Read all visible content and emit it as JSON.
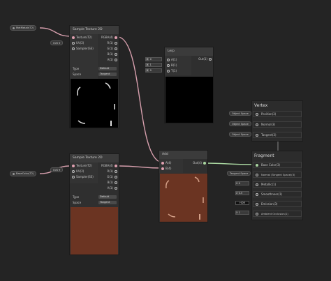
{
  "property_nodes": {
    "mettle": {
      "label": "MetMetalr(T2)"
    },
    "base": {
      "label": "BaseColor(T2)"
    }
  },
  "sample_top": {
    "title": "Sample Texture 2D",
    "inputs": [
      "Texture(T2)",
      "UV(2)",
      "Sampler(SS)"
    ],
    "outputs": [
      "RGBA(4)",
      "R(1)",
      "G(1)",
      "B(1)",
      "A(1)"
    ],
    "uv_chip": "UV0",
    "type_label": "Type",
    "type_value": "Default",
    "space_label": "Space",
    "space_value": "Tangent"
  },
  "sample_bottom": {
    "title": "Sample Texture 2D",
    "inputs": [
      "Texture(T2)",
      "UV(2)",
      "Sampler(SS)"
    ],
    "outputs": [
      "RGBA(4)",
      "R(1)",
      "G(1)",
      "B(1)",
      "A(1)"
    ],
    "uv_chip": "UV0",
    "type_label": "Type",
    "type_value": "Default",
    "space_label": "Space",
    "space_value": "Tangent"
  },
  "lerp": {
    "title": "Lerp",
    "inputs": [
      "A(1)",
      "B(1)",
      "T(1)"
    ],
    "output": "Out(1)",
    "fields": [
      {
        "axis": "X",
        "value": "0"
      },
      {
        "axis": "X",
        "value": "1"
      },
      {
        "axis": "X",
        "value": "0"
      }
    ]
  },
  "add": {
    "title": "Add",
    "inputs": [
      "A(4)",
      "B(4)"
    ],
    "output": "Out(4)"
  },
  "vertex": {
    "title": "Vertex",
    "slots": [
      {
        "chip": "Object Space",
        "label": "Position(3)"
      },
      {
        "chip": "Object Space",
        "label": "Normal(3)"
      },
      {
        "chip": "Object Space",
        "label": "Tangent(3)"
      }
    ]
  },
  "fragment": {
    "title": "Fragment",
    "slots": [
      {
        "chip": "",
        "label": "Base Color(3)"
      },
      {
        "chip": "Tangent Space",
        "label": "Normal (Tangent Space)(3)"
      },
      {
        "chip": "X 0",
        "label": "Metallic(1)"
      },
      {
        "chip": "X 0.5",
        "label": "Smoothness(1)"
      },
      {
        "chip": "HDR",
        "label": "Emission(3)"
      },
      {
        "chip": "X 1",
        "label": "Ambient Occlusion(1)"
      }
    ]
  },
  "colors": {
    "background": "#242424",
    "brown_preview": "#6b3422",
    "edge_pink": "#d8a0ae",
    "edge_green": "#a9d6a0"
  }
}
